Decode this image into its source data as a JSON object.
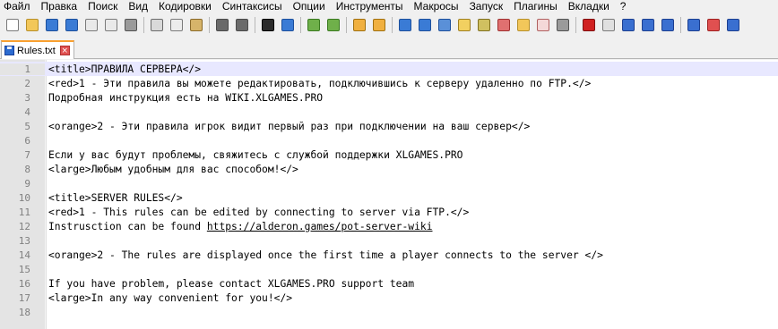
{
  "menu": [
    "Файл",
    "Правка",
    "Поиск",
    "Вид",
    "Кодировки",
    "Синтаксисы",
    "Опции",
    "Инструменты",
    "Макросы",
    "Запуск",
    "Плагины",
    "Вкладки",
    "?"
  ],
  "toolbar": {
    "buttons": [
      {
        "name": "new-file-icon",
        "color": "#ffffff",
        "border": "#7a7a7a"
      },
      {
        "name": "open-file-icon",
        "color": "#f2c75a",
        "border": "#b8902a"
      },
      {
        "name": "save-icon",
        "color": "#3a7bd5",
        "border": "#1c4f9c"
      },
      {
        "name": "save-all-icon",
        "color": "#3a7bd5",
        "border": "#1c4f9c"
      },
      {
        "name": "close-icon",
        "color": "#e9e9e9",
        "border": "#7a7a7a"
      },
      {
        "name": "close-all-icon",
        "color": "#e9e9e9",
        "border": "#7a7a7a"
      },
      {
        "name": "print-icon",
        "color": "#9a9a9a",
        "border": "#505050"
      },
      {
        "sep": true
      },
      {
        "name": "cut-icon",
        "color": "#d9d9d9",
        "border": "#6a6a6a"
      },
      {
        "name": "copy-icon",
        "color": "#ececec",
        "border": "#7a7a7a"
      },
      {
        "name": "paste-icon",
        "color": "#d6b46a",
        "border": "#8a6a2a"
      },
      {
        "sep": true
      },
      {
        "name": "undo-icon",
        "color": "#6a6a6a",
        "border": "#4a4a4a"
      },
      {
        "name": "redo-icon",
        "color": "#6a6a6a",
        "border": "#4a4a4a"
      },
      {
        "sep": true
      },
      {
        "name": "find-icon",
        "color": "#2a2a2a",
        "border": "#000000"
      },
      {
        "name": "replace-icon",
        "color": "#3a7bd5",
        "border": "#1c4f9c"
      },
      {
        "sep": true
      },
      {
        "name": "zoom-in-icon",
        "color": "#6fb04a",
        "border": "#3a7a20"
      },
      {
        "name": "zoom-out-icon",
        "color": "#6fb04a",
        "border": "#3a7a20"
      },
      {
        "sep": true
      },
      {
        "name": "sync-vertical-icon",
        "color": "#f0b040",
        "border": "#a07010"
      },
      {
        "name": "sync-horizontal-icon",
        "color": "#f0b040",
        "border": "#a07010"
      },
      {
        "sep": true
      },
      {
        "name": "word-wrap-icon",
        "color": "#3a7bd5",
        "border": "#1c4f9c"
      },
      {
        "name": "show-all-chars-icon",
        "color": "#3a7bd5",
        "border": "#1c4f9c"
      },
      {
        "name": "indent-guide-icon",
        "color": "#5a90d8",
        "border": "#1c4f9c"
      },
      {
        "name": "doc-map-icon",
        "color": "#f2d060",
        "border": "#a08020"
      },
      {
        "name": "function-list-icon",
        "color": "#d0c060",
        "border": "#807020"
      },
      {
        "name": "define-lang-icon",
        "color": "#e07070",
        "border": "#a03030"
      },
      {
        "name": "folder-workspace-icon",
        "color": "#f2c75a",
        "border": "#b8902a"
      },
      {
        "name": "monitor-icon",
        "color": "#f4d8d8",
        "border": "#b06060"
      },
      {
        "name": "eye-icon",
        "color": "#9a9a9a",
        "border": "#505050"
      },
      {
        "sep": true
      },
      {
        "name": "record-macro-icon",
        "color": "#d02020",
        "border": "#801010"
      },
      {
        "name": "stop-macro-icon",
        "color": "#e0e0e0",
        "border": "#7a7a7a"
      },
      {
        "name": "play-macro-icon",
        "color": "#3a6fd0",
        "border": "#1c3f90"
      },
      {
        "name": "run-macro-multiple-icon",
        "color": "#3a6fd0",
        "border": "#1c3f90"
      },
      {
        "name": "save-macro-icon",
        "color": "#3a6fd0",
        "border": "#1c3f90"
      },
      {
        "sep": true
      },
      {
        "name": "plugin-1-icon",
        "color": "#3a6fd0",
        "border": "#1c3f90"
      },
      {
        "name": "plugin-2-icon",
        "color": "#e05050",
        "border": "#a02020"
      },
      {
        "name": "plugin-3-icon",
        "color": "#3a6fd0",
        "border": "#1c3f90"
      }
    ]
  },
  "tab": {
    "label": "Rules.txt",
    "close_glyph": "×"
  },
  "editor": {
    "current_line": 1,
    "lines": [
      {
        "n": "1",
        "text": "<title>ПРАВИЛА СЕРВЕРА</>"
      },
      {
        "n": "2",
        "text": "<red>1 - Эти правила вы можете редактировать, подключившись к серверу удаленно по FTP.</>"
      },
      {
        "n": "3",
        "text": "Подробная инструкция есть на WIKI.XLGAMES.PRO"
      },
      {
        "n": "4",
        "text": ""
      },
      {
        "n": "5",
        "text": "<orange>2 - Эти правила игрок видит первый раз при подключении на ваш сервер</>"
      },
      {
        "n": "6",
        "text": ""
      },
      {
        "n": "7",
        "text": "Если у вас будут проблемы, свяжитесь с службой поддержки XLGAMES.PRO"
      },
      {
        "n": "8",
        "text": "<large>Любым удобным для вас способом!</>"
      },
      {
        "n": "9",
        "text": ""
      },
      {
        "n": "10",
        "text": "<title>SERVER RULES</>"
      },
      {
        "n": "11",
        "text": "<red>1 - This rules can be edited by connecting to server via FTP.</>"
      },
      {
        "n": "12",
        "prefix": "Instrusction can be found ",
        "url": "https://alderon.games/pot-server-wiki"
      },
      {
        "n": "13",
        "text": ""
      },
      {
        "n": "14",
        "text": "<orange>2 - The rules are displayed once the first time a player connects to the server </>"
      },
      {
        "n": "15",
        "text": ""
      },
      {
        "n": "16",
        "text": "If you have problem, please contact XLGAMES.PRO support team"
      },
      {
        "n": "17",
        "text": "<large>In any way convenient for you!</>"
      },
      {
        "n": "18",
        "text": ""
      }
    ]
  }
}
